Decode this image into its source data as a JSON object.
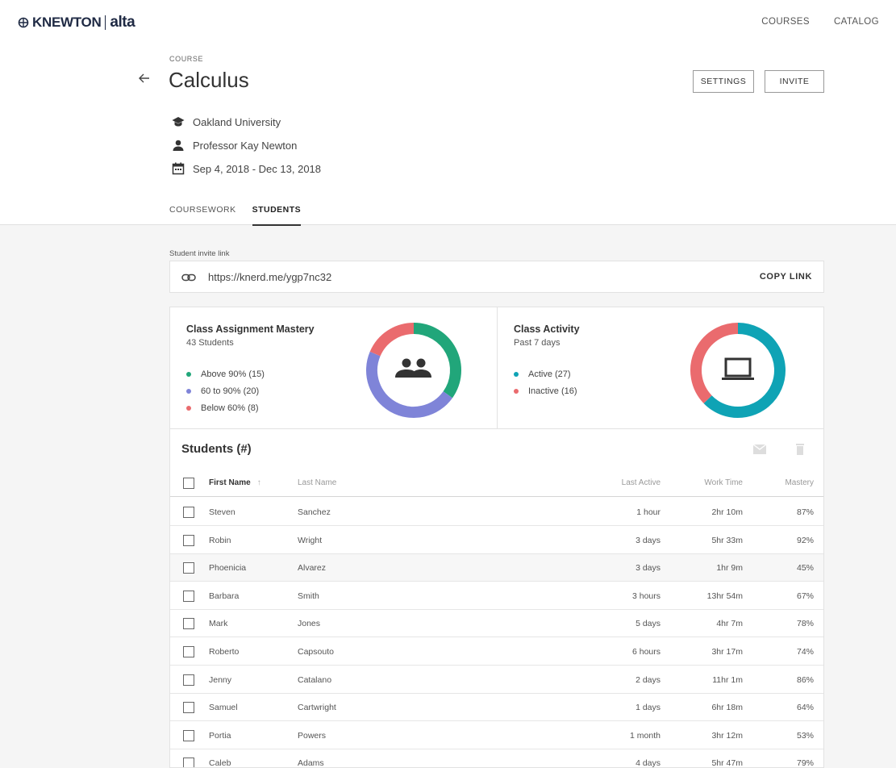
{
  "brand": {
    "name": "KNEWTON",
    "sub": "alta"
  },
  "nav": {
    "courses": "COURSES",
    "catalog": "CATALOG"
  },
  "course": {
    "eyebrow": "COURSE",
    "title": "Calculus",
    "school": "Oakland University",
    "professor": "Professor Kay Newton",
    "dates": "Sep 4, 2018 - Dec 13, 2018"
  },
  "buttons": {
    "settings": "SETTINGS",
    "invite": "INVITE"
  },
  "tabs": [
    {
      "label": "COURSEWORK",
      "active": false
    },
    {
      "label": "STUDENTS",
      "active": true
    }
  ],
  "invite": {
    "label": "Student invite link",
    "url": "https://knerd.me/ygp7nc32",
    "copy": "COPY LINK"
  },
  "mastery": {
    "title": "Class Assignment Mastery",
    "subtitle": "43 Students",
    "legend": [
      "Above 90% (15)",
      "60 to 90% (20)",
      "Below 60% (8)"
    ],
    "values": [
      15,
      20,
      8
    ]
  },
  "activity": {
    "title": "Class Activity",
    "subtitle": "Past 7 days",
    "legend": [
      "Active (27)",
      "Inactive (16)"
    ],
    "values": [
      27,
      16
    ]
  },
  "colors": {
    "green": "#21a67a",
    "purple": "#7f84d8",
    "red": "#ea6b6e",
    "teal": "#0fa3b5",
    "icon": "#333333"
  },
  "students": {
    "title": "Students (#)",
    "columns": {
      "first": "First Name",
      "last": "Last Name",
      "active": "Last Active",
      "time": "Work Time",
      "mastery": "Mastery"
    },
    "rows": [
      {
        "first": "Steven",
        "last": "Sanchez",
        "active": "1 hour",
        "time": "2hr 10m",
        "mastery": "87%"
      },
      {
        "first": "Robin",
        "last": "Wright",
        "active": "3 days",
        "time": "5hr 33m",
        "mastery": "92%"
      },
      {
        "first": "Phoenicia",
        "last": "Alvarez",
        "active": "3 days",
        "time": "1hr 9m",
        "mastery": "45%"
      },
      {
        "first": "Barbara",
        "last": "Smith",
        "active": "3 hours",
        "time": "13hr 54m",
        "mastery": "67%"
      },
      {
        "first": "Mark",
        "last": "Jones",
        "active": "5 days",
        "time": "4hr 7m",
        "mastery": "78%"
      },
      {
        "first": "Roberto",
        "last": "Capsouto",
        "active": "6 hours",
        "time": "3hr 17m",
        "mastery": "74%"
      },
      {
        "first": "Jenny",
        "last": "Catalano",
        "active": "2 days",
        "time": "11hr 1m",
        "mastery": "86%"
      },
      {
        "first": "Samuel",
        "last": "Cartwright",
        "active": "1 days",
        "time": "6hr 18m",
        "mastery": "64%"
      },
      {
        "first": "Portia",
        "last": "Powers",
        "active": "1 month",
        "time": "3hr 12m",
        "mastery": "53%"
      },
      {
        "first": "Caleb",
        "last": "Adams",
        "active": "4 days",
        "time": "5hr 47m",
        "mastery": "79%"
      }
    ]
  }
}
